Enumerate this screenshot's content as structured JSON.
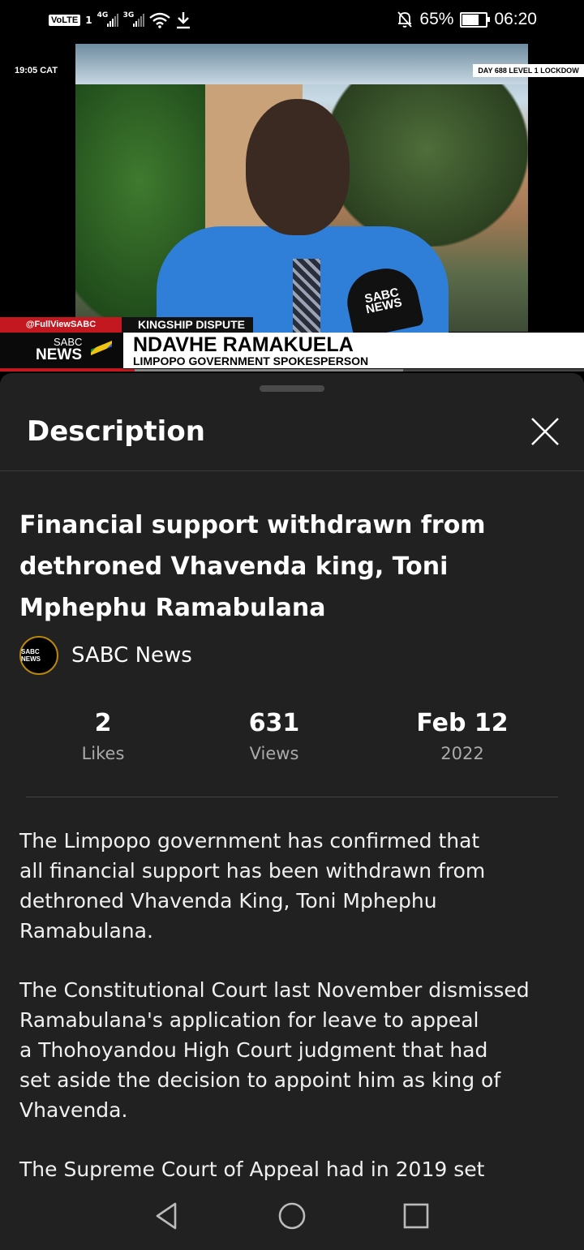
{
  "status_bar": {
    "volte": "VoLTE",
    "sim_number": "1",
    "signal1_gen": "4G",
    "signal2_gen": "3G",
    "icons": [
      "wifi-icon",
      "download-icon",
      "mute-bell-icon",
      "battery-icon"
    ],
    "battery": "65%",
    "battery_level": 0.65,
    "time": "06:20"
  },
  "video": {
    "timestamp": "19:05 CAT",
    "top_banner": "DAY 688 LEVEL 1 LOCKDOW",
    "handle": "@FullViewSABC",
    "topic": "KINGSHIP DISPUTE",
    "logo_line1": "SABC",
    "logo_line2": "NEWS",
    "speaker_name": "NDAVHE RAMAKUELA",
    "speaker_title": "LIMPOPO GOVERNMENT SPOKESPERSON",
    "mic_label": "SABC NEWS",
    "progress_played": 0.23,
    "progress_buffered": 0.69
  },
  "sheet": {
    "title": "Description",
    "video_title": "Financial support withdrawn from dethroned Vhavenda king, Toni Mphephu Ramabulana",
    "channel": {
      "name": "SABC News",
      "avatar_text": "SABC NEWS"
    },
    "stats": [
      {
        "value": "2",
        "label": "Likes"
      },
      {
        "value": "631",
        "label": "Views"
      },
      {
        "value": "Feb 12",
        "label": "2022"
      }
    ],
    "description": [
      "The Limpopo government has confirmed that\nall financial support has been withdrawn from\ndethroned Vhavenda King, Toni Mphephu\nRamabulana.",
      "The Constitutional Court last November dismissed\nRamabulana's application for leave to appeal\na Thohoyandou High Court judgment that had\nset aside the decision to appoint him as king of\nVhavenda.",
      "The Supreme Court of Appeal had in 2019 set"
    ]
  },
  "colors": {
    "sheet_bg": "#212121",
    "accent_red": "#c3181f"
  },
  "navbar": {
    "icons": [
      "back-icon",
      "home-icon",
      "recents-icon"
    ]
  }
}
